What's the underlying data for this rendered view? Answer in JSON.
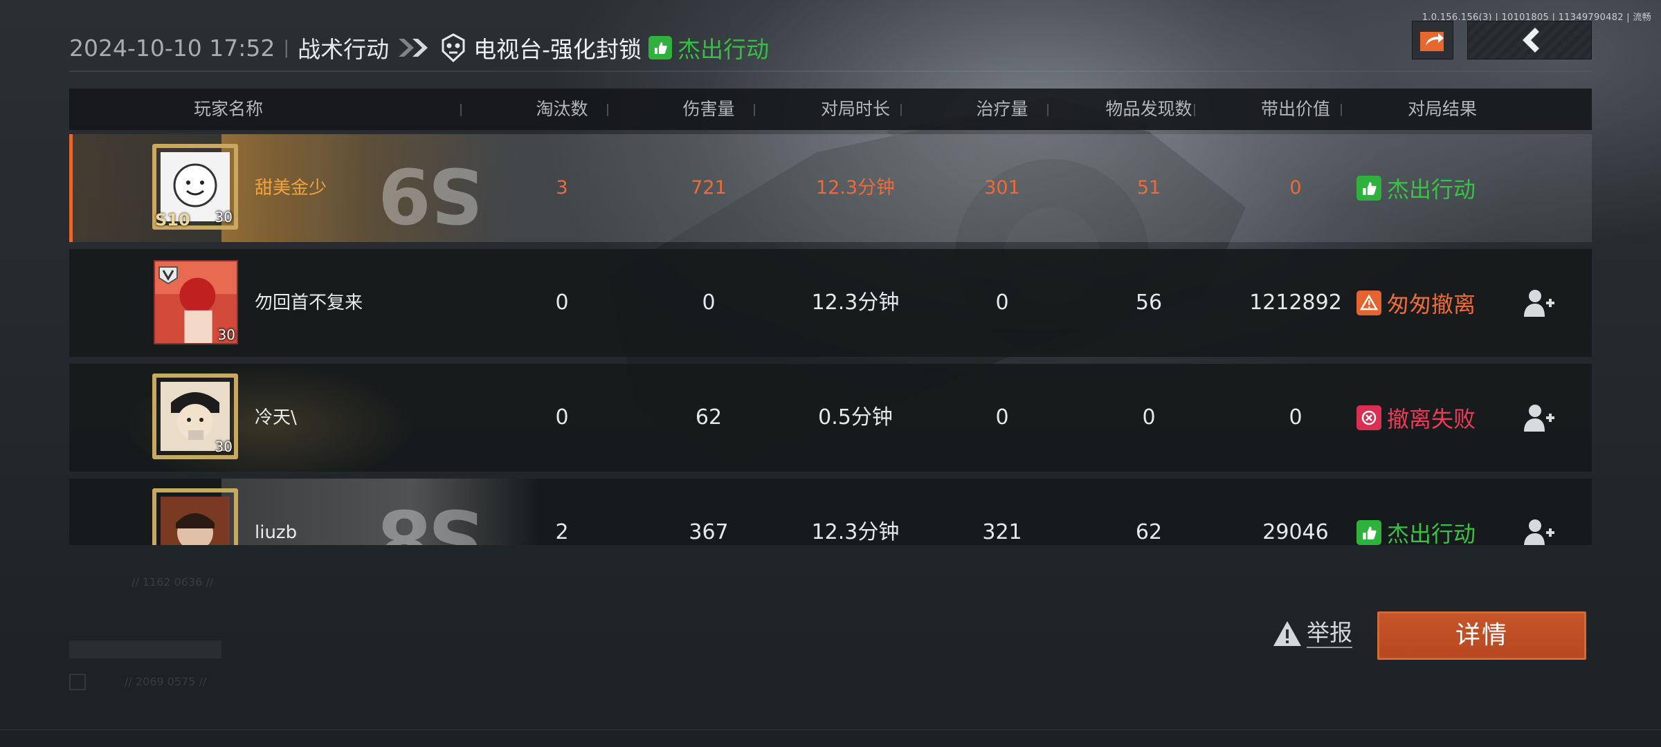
{
  "build_info": "1.0.156.156(3) | 10101805 | 11349790482 | 流畅",
  "header": {
    "datetime": "2024-10-10 17:52",
    "separator": "|",
    "mode": "战术行动",
    "map": "电视台-强化封锁",
    "result": "杰出行动"
  },
  "table": {
    "columns": [
      "玩家名称",
      "淘汰数",
      "伤害量",
      "对局时长",
      "治疗量",
      "物品发现数",
      "带出价值",
      "对局结果"
    ],
    "rows": [
      {
        "name": "甜美金少",
        "level": "30",
        "season_badge": "S10",
        "kills": "3",
        "damage": "721",
        "duration": "12.3分钟",
        "healing": "301",
        "items_found": "51",
        "extract_value": "0",
        "result": "杰出行动",
        "is_self": true
      },
      {
        "name": "勿回首不复来",
        "level": "30",
        "kills": "0",
        "damage": "0",
        "duration": "12.3分钟",
        "healing": "0",
        "items_found": "56",
        "extract_value": "1212892",
        "result": "匆匆撤离"
      },
      {
        "name": "冷天\\",
        "level": "30",
        "kills": "0",
        "damage": "62",
        "duration": "0.5分钟",
        "healing": "0",
        "items_found": "0",
        "extract_value": "0",
        "result": "撤离失败"
      },
      {
        "name": "liuzb",
        "kills": "2",
        "damage": "367",
        "duration": "12.3分钟",
        "healing": "321",
        "items_found": "62",
        "extract_value": "29046",
        "result": "杰出行动"
      }
    ]
  },
  "footer": {
    "report_label": "举报",
    "details_label": "详情"
  },
  "colors": {
    "accent_orange": "#e8672f",
    "success_green": "#37c444",
    "warning_orange": "#ee6a37",
    "fail_red": "#ec3a5a"
  },
  "icons": [
    "share-icon",
    "back-arrow-icon",
    "double-chevron-icon",
    "map-skull-icon",
    "result-hand-icon",
    "warning-icon",
    "fail-icon",
    "add-friend-icon",
    "report-warning-icon"
  ]
}
